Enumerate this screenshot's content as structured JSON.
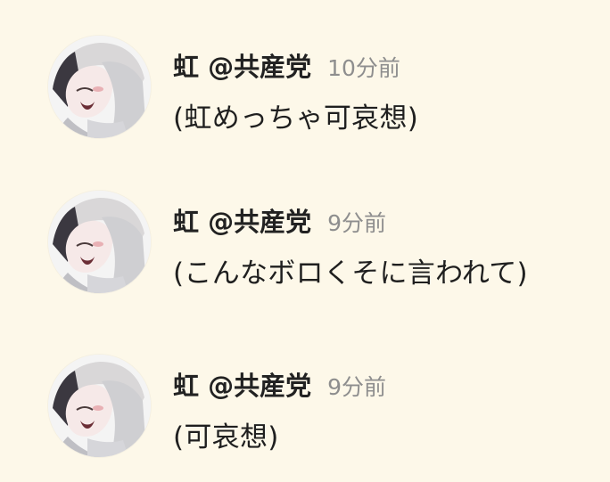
{
  "background_color": "#fdf8e9",
  "messages": [
    {
      "name": "虹 @共産党",
      "time": "10分前",
      "text": "(虹めっちゃ可哀想)",
      "avatar_icon": "anime-avatar-icon"
    },
    {
      "name": "虹 @共産党",
      "time": "9分前",
      "text": "(こんなボロくそに言われて)",
      "avatar_icon": "anime-avatar-icon"
    },
    {
      "name": "虹 @共産党",
      "time": "9分前",
      "text": "(可哀想)",
      "avatar_icon": "anime-avatar-icon"
    }
  ]
}
